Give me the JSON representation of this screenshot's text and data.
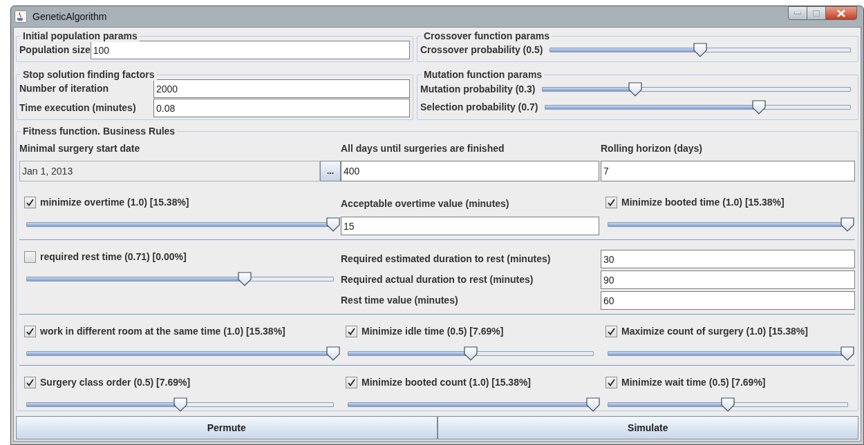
{
  "window": {
    "title": "GeneticAlgorithm"
  },
  "initial_population": {
    "title": "Initial population params",
    "fields": [
      {
        "label": "Population size",
        "value": "100"
      }
    ]
  },
  "crossover": {
    "title": "Crossover function params",
    "sliders": [
      {
        "label": "Crossover probability (0.5)",
        "level": 0.5
      }
    ]
  },
  "stop_factors": {
    "title": "Stop solution finding factors",
    "fields": [
      {
        "label": "Number of iteration",
        "value": "2000"
      },
      {
        "label": "Time execution (minutes)",
        "value": "0.08"
      }
    ]
  },
  "mutation": {
    "title": "Mutation function params",
    "sliders": [
      {
        "label": "Mutation probability (0.3)",
        "level": 0.3
      },
      {
        "label": "Selection probability (0.7)",
        "level": 0.7
      }
    ]
  },
  "fitness": {
    "title": "Fitness function. Business Rules",
    "start_date": {
      "label": "Minimal surgery start date",
      "value": "Jan 1, 2013",
      "button": "..."
    },
    "days_until": {
      "label": "All days until surgeries are finished",
      "value": "400"
    },
    "rolling_horizon": {
      "label": "Rolling horizon (days)",
      "value": "7"
    },
    "rows": [
      {
        "cells": [
          {
            "kind": "rule",
            "label": "minimize overtime (1.0) [15.38%]",
            "checked": true,
            "level": 1.0
          },
          {
            "kind": "field",
            "label": "Acceptable overtime value (minutes)",
            "value": "15"
          },
          {
            "kind": "rule",
            "label": "Minimize booted time (1.0) [15.38%]",
            "checked": true,
            "level": 1.0
          }
        ]
      },
      {
        "cells": [
          {
            "kind": "rule",
            "label": "required rest time (0.71) [0.00%]",
            "checked": false,
            "level": 0.71
          },
          {
            "kind": "fields",
            "fields": [
              {
                "label": "Required estimated duration to rest (minutes)",
                "value": "30"
              },
              {
                "label": "Required actual duration to rest (minutes)",
                "value": "90"
              },
              {
                "label": "Rest time value (minutes)",
                "value": "60"
              }
            ]
          }
        ]
      },
      {
        "cells": [
          {
            "kind": "rule",
            "label": "work in different room at the same time (1.0) [15.38%]",
            "checked": true,
            "level": 1.0
          },
          {
            "kind": "rule",
            "label": "Minimize idle time (0.5) [7.69%]",
            "checked": true,
            "level": 0.5
          },
          {
            "kind": "rule",
            "label": "Maximize count of surgery (1.0) [15.38%]",
            "checked": true,
            "level": 1.0
          }
        ]
      },
      {
        "cells": [
          {
            "kind": "rule",
            "label": "Surgery class order (0.5) [7.69%]",
            "checked": true,
            "level": 0.5
          },
          {
            "kind": "rule",
            "label": "Minimize booted count (1.0) [15.38%]",
            "checked": true,
            "level": 1.0
          },
          {
            "kind": "rule",
            "label": "Minimize wait time (0.5) [7.69%]",
            "checked": true,
            "level": 0.5
          }
        ]
      }
    ]
  },
  "buttons": [
    "Permute",
    "Simulate"
  ]
}
